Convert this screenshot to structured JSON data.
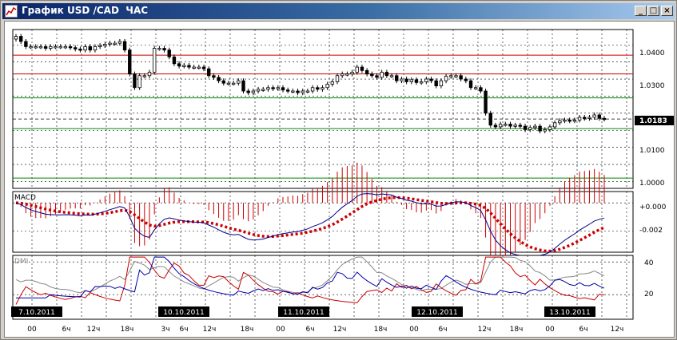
{
  "window": {
    "title": "График USD /CAD  ЧАС",
    "buttons": [
      "_",
      "□",
      "×"
    ]
  },
  "chart_data": [
    {
      "type": "candlestick",
      "panel": "price",
      "grid": true,
      "y_ticks": [
        "1.0400",
        "1.0300",
        "1.0183",
        "1.0100",
        "1.0000"
      ],
      "ylim": [
        0.998,
        1.0445
      ],
      "last_price": "1.0183",
      "horizontal_lines": [
        {
          "value": 1.037,
          "color": "#cc0000"
        },
        {
          "value": 1.0315,
          "color": "#cc0000"
        },
        {
          "value": 1.0245,
          "color": "#008800"
        },
        {
          "value": 1.0155,
          "color": "#008800"
        },
        {
          "value": 1.001,
          "color": "#008800"
        }
      ],
      "closes": [
        1.0425,
        1.041,
        1.0395,
        1.0395,
        1.0395,
        1.0395,
        1.039,
        1.0395,
        1.0395,
        1.0395,
        1.0395,
        1.0392,
        1.0388,
        1.0385,
        1.0395,
        1.0385,
        1.0395,
        1.0398,
        1.0402,
        1.0405,
        1.0405,
        1.041,
        1.0385,
        1.0315,
        1.0275,
        1.031,
        1.031,
        1.032,
        1.039,
        1.039,
        1.0385,
        1.0365,
        1.0345,
        1.0338,
        1.034,
        1.0335,
        1.0335,
        1.0335,
        1.033,
        1.031,
        1.0305,
        1.0295,
        1.0288,
        1.0288,
        1.0288,
        1.0295,
        1.0265,
        1.026,
        1.0265,
        1.027,
        1.027,
        1.0275,
        1.0272,
        1.0275,
        1.0268,
        1.0265,
        1.0265,
        1.026,
        1.0265,
        1.0265,
        1.0275,
        1.027,
        1.0275,
        1.0285,
        1.0292,
        1.031,
        1.0315,
        1.0315,
        1.032,
        1.0335,
        1.0325,
        1.0315,
        1.031,
        1.0305,
        1.032,
        1.031,
        1.031,
        1.0295,
        1.03,
        1.0292,
        1.0298,
        1.029,
        1.0292,
        1.03,
        1.0295,
        1.028,
        1.0295,
        1.0308,
        1.031,
        1.031,
        1.03,
        1.0295,
        1.0275,
        1.0275,
        1.0265,
        1.02,
        1.0165,
        1.016,
        1.0168,
        1.0168,
        1.0162,
        1.0165,
        1.0162,
        1.0152,
        1.0158,
        1.0162,
        1.0148,
        1.0152,
        1.016,
        1.0172,
        1.0178,
        1.018,
        1.0178,
        1.018,
        1.0188,
        1.0185,
        1.0188,
        1.0195,
        1.0185,
        1.0183
      ]
    },
    {
      "type": "bar+line",
      "panel": "macd",
      "label": "MACD",
      "y_ticks": [
        "+0.000",
        "-0.002"
      ],
      "ylim": [
        -0.0035,
        0.0008
      ]
    },
    {
      "type": "line",
      "panel": "dmi",
      "label": "DMI",
      "y_ticks": [
        "40",
        "20"
      ],
      "ylim": [
        5,
        44
      ]
    }
  ],
  "time_axis": {
    "date_badges": [
      "7.10.2011",
      "10.10.2011",
      "11.10.2011",
      "12.10.2011",
      "13.10.2011"
    ],
    "hour_labels": [
      "00",
      "6ч",
      "12ч",
      "18ч",
      "3ч",
      "6ч",
      "12ч",
      "18ч",
      "00",
      "6ч",
      "12ч",
      "18ч",
      "00",
      "6ч",
      "12ч",
      "18ч",
      "00",
      "6ч",
      "12ч"
    ]
  },
  "colors": {
    "candle_body": "#000000",
    "macd_histogram": "#cc0000",
    "macd_signal": "#cc0000",
    "macd_line": "#00008b",
    "dmi_plus": "#0000aa",
    "dmi_minus": "#cc0000",
    "adx": "#888888"
  }
}
